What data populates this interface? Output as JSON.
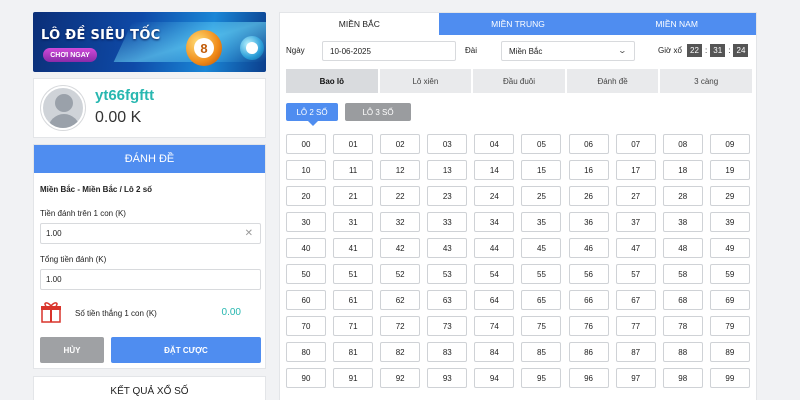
{
  "banner": {
    "title": "LÔ ĐỀ SIÊU TỐC",
    "cta": "CHƠI NGAY",
    "ball_number": "8"
  },
  "user": {
    "name": "yt66fgftt",
    "balance": "0.00 K"
  },
  "bet_panel": {
    "header": "ĐÁNH ĐỀ",
    "selection": "Miền Bắc - Miền Bắc / Lô 2 số",
    "per_unit_label": "Tiền đánh trên 1 con (K)",
    "per_unit_value": "1.00",
    "total_label": "Tổng tiền đánh (K)",
    "total_value": "1.00",
    "win_label": "Số tiền thắng 1 con (K)",
    "win_value": "0.00",
    "cancel_label": "HỦY",
    "submit_label": "ĐẶT CƯỢC"
  },
  "results": {
    "title": "KẾT QUẢ XỔ SỐ"
  },
  "regions": [
    "MIỀN BẮC",
    "MIỀN TRUNG",
    "MIỀN NAM"
  ],
  "filters": {
    "date_label": "Ngày",
    "date_value": "10-06-2025",
    "station_label": "Đài",
    "station_value": "Miền Bắc",
    "time_label": "Giờ xổ",
    "time_h": "22",
    "time_m": "31",
    "time_s": "24"
  },
  "bet_types": [
    "Bao lô",
    "Lô xiên",
    "Đầu đuôi",
    "Đánh đề",
    "3 càng"
  ],
  "sub_tabs": [
    "LÔ 2 SỐ",
    "LÔ 3 SỐ"
  ],
  "colors": {
    "accent": "#4f8df0",
    "teal": "#27b7b0"
  }
}
